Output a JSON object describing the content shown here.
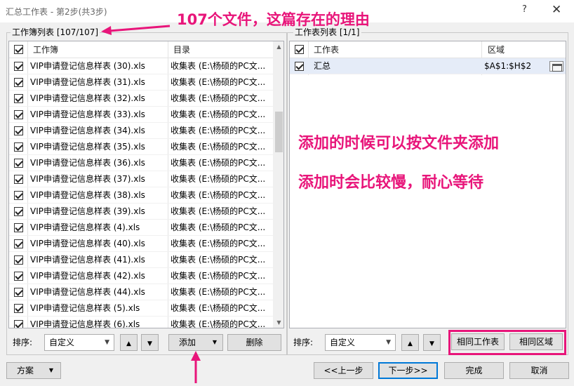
{
  "window": {
    "title": "汇总工作表 - 第2步(共3步)",
    "help": "?",
    "close": "✕"
  },
  "left_group": {
    "label": "工作簿列表 [107/107]",
    "columns": {
      "workbook": "工作簿",
      "directory": "目录"
    },
    "rows": [
      {
        "name": "VIP申请登记信息样表 (30).xls",
        "dir": "收集表 (E:\\杨硕的PC文..."
      },
      {
        "name": "VIP申请登记信息样表 (31).xls",
        "dir": "收集表 (E:\\杨硕的PC文..."
      },
      {
        "name": "VIP申请登记信息样表 (32).xls",
        "dir": "收集表 (E:\\杨硕的PC文..."
      },
      {
        "name": "VIP申请登记信息样表 (33).xls",
        "dir": "收集表 (E:\\杨硕的PC文..."
      },
      {
        "name": "VIP申请登记信息样表 (34).xls",
        "dir": "收集表 (E:\\杨硕的PC文..."
      },
      {
        "name": "VIP申请登记信息样表 (35).xls",
        "dir": "收集表 (E:\\杨硕的PC文..."
      },
      {
        "name": "VIP申请登记信息样表 (36).xls",
        "dir": "收集表 (E:\\杨硕的PC文..."
      },
      {
        "name": "VIP申请登记信息样表 (37).xls",
        "dir": "收集表 (E:\\杨硕的PC文..."
      },
      {
        "name": "VIP申请登记信息样表 (38).xls",
        "dir": "收集表 (E:\\杨硕的PC文..."
      },
      {
        "name": "VIP申请登记信息样表 (39).xls",
        "dir": "收集表 (E:\\杨硕的PC文..."
      },
      {
        "name": "VIP申请登记信息样表 (4).xls",
        "dir": "收集表 (E:\\杨硕的PC文..."
      },
      {
        "name": "VIP申请登记信息样表 (40).xls",
        "dir": "收集表 (E:\\杨硕的PC文..."
      },
      {
        "name": "VIP申请登记信息样表 (41).xls",
        "dir": "收集表 (E:\\杨硕的PC文..."
      },
      {
        "name": "VIP申请登记信息样表 (42).xls",
        "dir": "收集表 (E:\\杨硕的PC文..."
      },
      {
        "name": "VIP申请登记信息样表 (44).xls",
        "dir": "收集表 (E:\\杨硕的PC文..."
      },
      {
        "name": "VIP申请登记信息样表 (5).xls",
        "dir": "收集表 (E:\\杨硕的PC文..."
      },
      {
        "name": "VIP申请登记信息样表 (6).xls",
        "dir": "收集表 (E:\\杨硕的PC文..."
      }
    ],
    "sort_label": "排序:",
    "sort_value": "自定义",
    "add_label": "添加",
    "delete_label": "删除"
  },
  "right_group": {
    "label": "工作表列表 [1/1]",
    "columns": {
      "sheet": "工作表",
      "range": "区域"
    },
    "rows": [
      {
        "sheet": "汇总",
        "range": "$A$1:$H$2"
      }
    ],
    "sort_label": "排序:",
    "sort_value": "自定义",
    "same_sheet_label": "相同工作表",
    "same_range_label": "相同区域"
  },
  "footer": {
    "scheme_label": "方案",
    "prev_label": "<<上一步",
    "next_label": "下一步>>",
    "finish_label": "完成",
    "cancel_label": "取消"
  },
  "annotations": {
    "top_note": "107个文件，这篇存在的理由",
    "note_1": "添加的时候可以按文件夹添加",
    "note_2": "添加时会比较慢，耐心等待"
  },
  "colors": {
    "annotation": "#e8157a",
    "focus": "#0078d7",
    "selected_row": "#e5ecf8"
  }
}
